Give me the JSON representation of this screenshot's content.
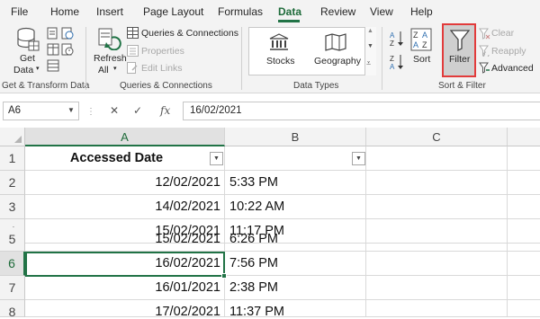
{
  "tabs": [
    "File",
    "Home",
    "Insert",
    "Page Layout",
    "Formulas",
    "Data",
    "Review",
    "View",
    "Help"
  ],
  "active_tab": "Data",
  "ribbon": {
    "get_transform": {
      "get_data_line1": "Get",
      "get_data_line2": "Data",
      "group_label": "Get & Transform Data"
    },
    "queries": {
      "refresh_line1": "Refresh",
      "refresh_line2": "All",
      "queries_connections": "Queries & Connections",
      "properties": "Properties",
      "edit_links": "Edit Links",
      "group_label": "Queries & Connections"
    },
    "data_types": {
      "stocks": "Stocks",
      "geography": "Geography",
      "group_label": "Data Types"
    },
    "sort_filter": {
      "sort": "Sort",
      "filter": "Filter",
      "clear": "Clear",
      "reapply": "Reapply",
      "advanced": "Advanced",
      "group_label": "Sort & Filter"
    }
  },
  "formula_bar": {
    "name_box": "A6",
    "fx": "fx",
    "value": "16/02/2021"
  },
  "grid": {
    "columns": [
      "A",
      "B",
      "C"
    ],
    "selected_column": "A",
    "header_row": {
      "row": "1",
      "a": "Accessed Date",
      "b": ""
    },
    "rows": [
      {
        "row": "2",
        "a": "12/02/2021",
        "b": "5:33 PM"
      },
      {
        "row": "3",
        "a": "14/02/2021",
        "b": "10:22 AM"
      },
      {
        "row": "4",
        "a": "15/02/2021",
        "b": "11:17 PM"
      },
      {
        "row": "5",
        "a": "15/02/2021",
        "b": "6:26 PM"
      },
      {
        "row": "6",
        "a": "16/02/2021",
        "b": "7:56 PM"
      },
      {
        "row": "7",
        "a": "16/01/2021",
        "b": "2:38 PM"
      },
      {
        "row": "8",
        "a": "17/02/2021",
        "b": "11:37 PM"
      }
    ],
    "selected_row": "6",
    "active_cell": "A6"
  },
  "colors": {
    "accent": "#217346",
    "highlight_border": "#e23b3b"
  }
}
